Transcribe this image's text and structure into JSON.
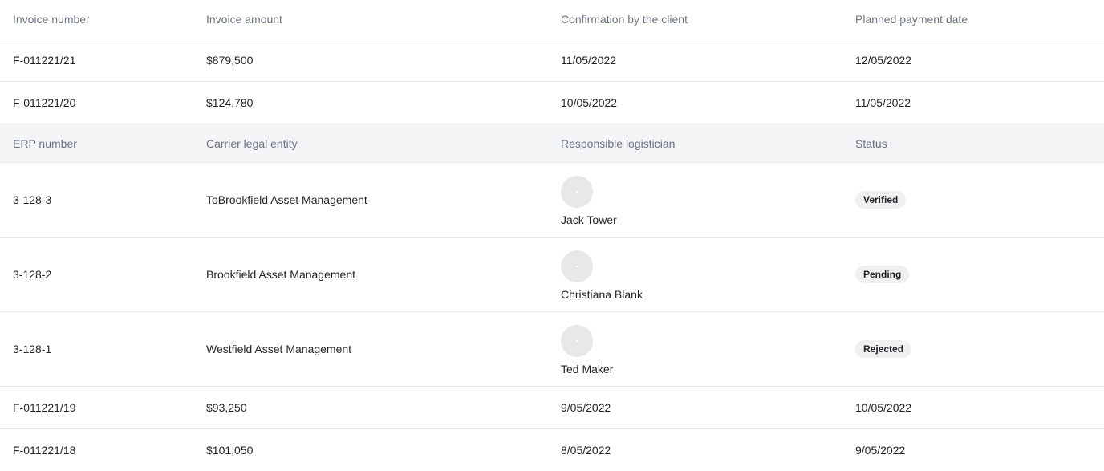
{
  "invoice_header": {
    "invoice_number": "Invoice number",
    "invoice_amount": "Invoice amount",
    "confirmation": "Confirmation by the client",
    "planned_date": "Planned payment date"
  },
  "invoices_top": [
    {
      "number": "F-011221/21",
      "amount": "$879,500",
      "confirmation": "11/05/2022",
      "planned": "12/05/2022"
    },
    {
      "number": "F-011221/20",
      "amount": "$124,780",
      "confirmation": "10/05/2022",
      "planned": "11/05/2022"
    }
  ],
  "detail_header": {
    "erp_number": "ERP number",
    "carrier": "Carrier legal entity",
    "logistician": "Responsible logistician",
    "status": "Status"
  },
  "details": [
    {
      "erp": "3-128-3",
      "carrier": "ToBrookfield Asset Management",
      "logistician": "Jack Tower",
      "status": "Verified"
    },
    {
      "erp": "3-128-2",
      "carrier": "Brookfield Asset Management",
      "logistician": "Christiana Blank",
      "status": "Pending"
    },
    {
      "erp": "3-128-1",
      "carrier": "Westfield Asset Management",
      "logistician": "Ted Maker",
      "status": "Rejected"
    }
  ],
  "invoices_bottom": [
    {
      "number": "F-011221/19",
      "amount": "$93,250",
      "confirmation": "9/05/2022",
      "planned": "10/05/2022"
    },
    {
      "number": "F-011221/18",
      "amount": "$101,050",
      "confirmation": "8/05/2022",
      "planned": "9/05/2022"
    }
  ],
  "colors": {
    "header_text": "#6b7280",
    "subheader_bg": "#f3f4f6",
    "badge_bg": "#f0f0f0",
    "avatar_bg": "#e8e8e8",
    "divider": "#e6e8eb"
  }
}
